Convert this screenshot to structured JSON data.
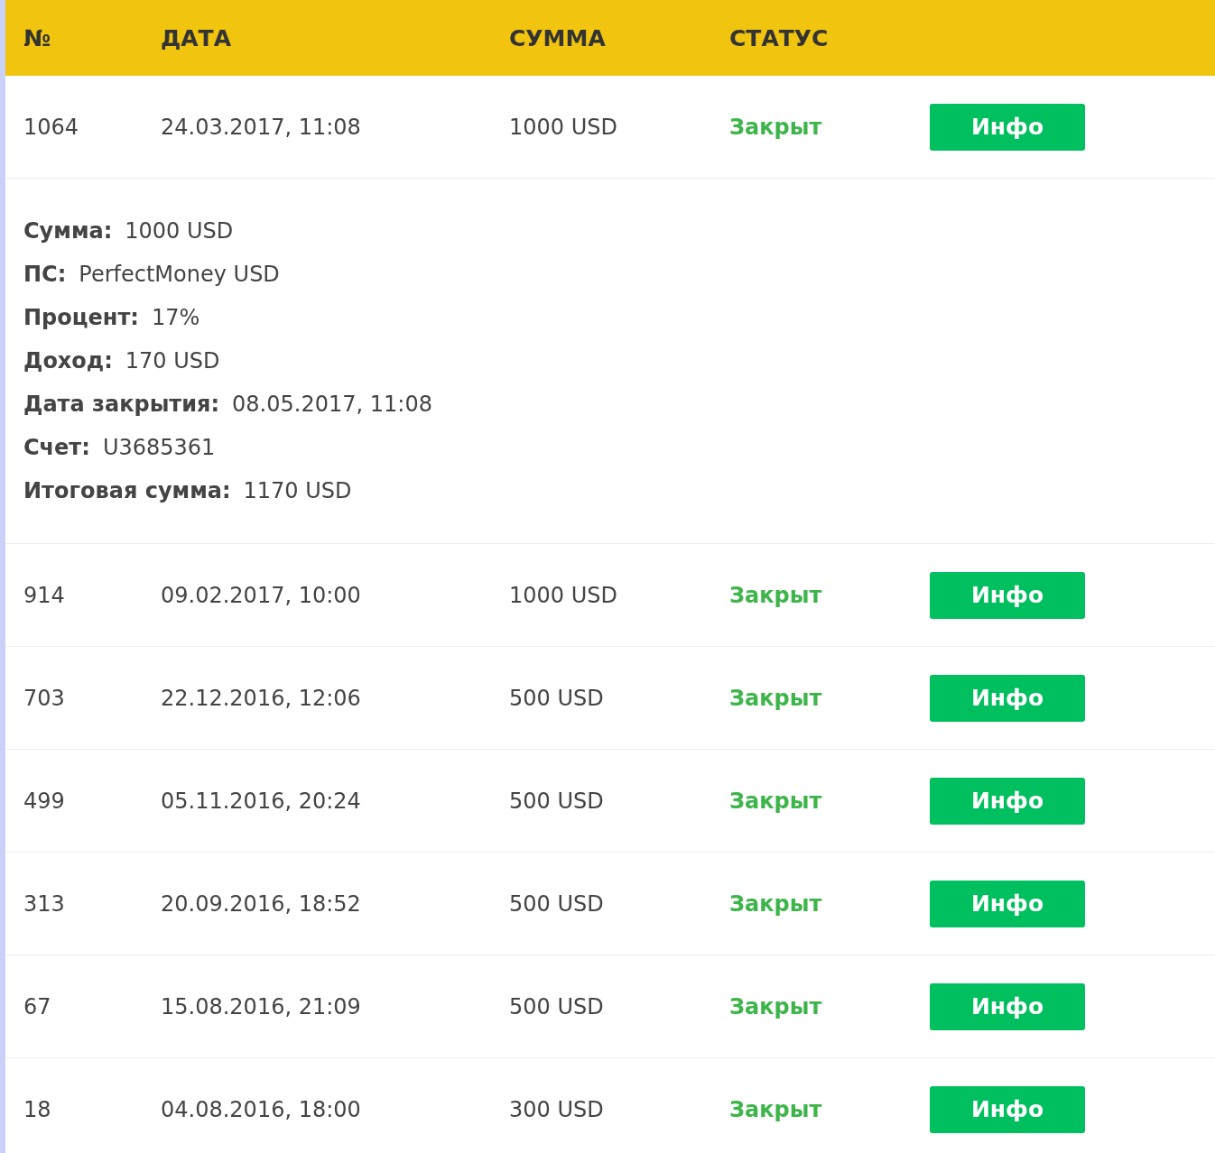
{
  "table": {
    "columns": [
      "№",
      "ДАТА",
      "СУММА",
      "СТАТУС"
    ],
    "rows": [
      {
        "number": "1064",
        "date": "24.03.2017, 11:08",
        "amount": "1000 USD",
        "status": "Закрыт",
        "button": "Инфо",
        "details": [
          {
            "label": "Сумма:",
            "value": "1000 USD"
          },
          {
            "label": "ПС:",
            "value": "PerfectMoney USD"
          },
          {
            "label": "Процент:",
            "value": "17%"
          },
          {
            "label": "Доход:",
            "value": "170 USD"
          },
          {
            "label": "Дата закрытия:",
            "value": "08.05.2017, 11:08"
          },
          {
            "label": "Счет:",
            "value": "U3685361"
          },
          {
            "label": "Итоговая сумма:",
            "value": "1170 USD"
          }
        ]
      },
      {
        "number": "914",
        "date": "09.02.2017, 10:00",
        "amount": "1000 USD",
        "status": "Закрыт",
        "button": "Инфо"
      },
      {
        "number": "703",
        "date": "22.12.2016, 12:06",
        "amount": "500 USD",
        "status": "Закрыт",
        "button": "Инфо"
      },
      {
        "number": "499",
        "date": "05.11.2016, 20:24",
        "amount": "500 USD",
        "status": "Закрыт",
        "button": "Инфо"
      },
      {
        "number": "313",
        "date": "20.09.2016, 18:52",
        "amount": "500 USD",
        "status": "Закрыт",
        "button": "Инфо"
      },
      {
        "number": "67",
        "date": "15.08.2016, 21:09",
        "amount": "500 USD",
        "status": "Закрыт",
        "button": "Инфо"
      },
      {
        "number": "18",
        "date": "04.08.2016, 18:00",
        "amount": "300 USD",
        "status": "Закрыт",
        "button": "Инфо"
      }
    ]
  }
}
